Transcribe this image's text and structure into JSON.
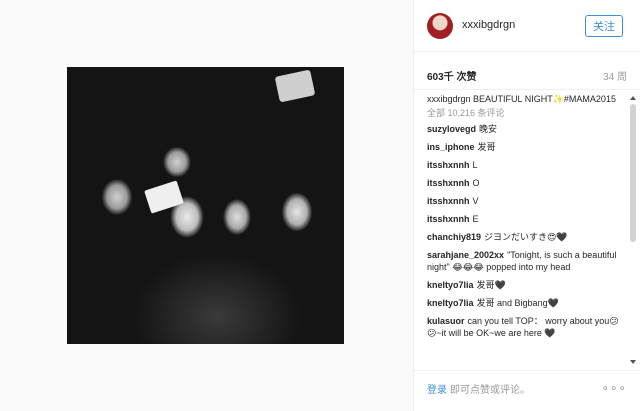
{
  "post": {
    "photo_alt": "Black and white group photo"
  },
  "header": {
    "username": "xxxibgdrgn",
    "follow_label": "关注"
  },
  "stats": {
    "likes": "603千 次赞",
    "time": "34 周"
  },
  "caption": {
    "username": "xxxibgdrgn",
    "text": "BEAUTIFUL NIGHT✨#MAMA2015"
  },
  "view_all": "全部 10,216 条评论",
  "comments": [
    {
      "user": "suzylovegd",
      "text": "晚安"
    },
    {
      "user": "ins_iphone",
      "text": "发哥"
    },
    {
      "user": "itsshxnnh",
      "text": "L"
    },
    {
      "user": "itsshxnnh",
      "text": "O"
    },
    {
      "user": "itsshxnnh",
      "text": "V"
    },
    {
      "user": "itsshxnnh",
      "text": "E"
    },
    {
      "user": "chanchiy819",
      "text": "ジヨンだいすき😍🖤"
    },
    {
      "user": "sarahjane_2002xx",
      "text": "\"Tonight, is such a beautiful night\" 😂😂😂 popped into my head"
    },
    {
      "user": "kneltyo7lia",
      "text": "发哥🖤"
    },
    {
      "user": "kneltyo7lia",
      "text": "发哥 and Bigbang🖤"
    },
    {
      "user": "kulasuor",
      "text": "can you tell TOP： worry about you😕😕~it will be OK~we are here 🖤"
    }
  ],
  "footer": {
    "login": "登录",
    "prompt": "即可点赞或评论。",
    "more_icon": "more-dots-icon"
  },
  "colors": {
    "accent": "#3f8fd6",
    "muted": "#999999",
    "border": "#efefef"
  }
}
